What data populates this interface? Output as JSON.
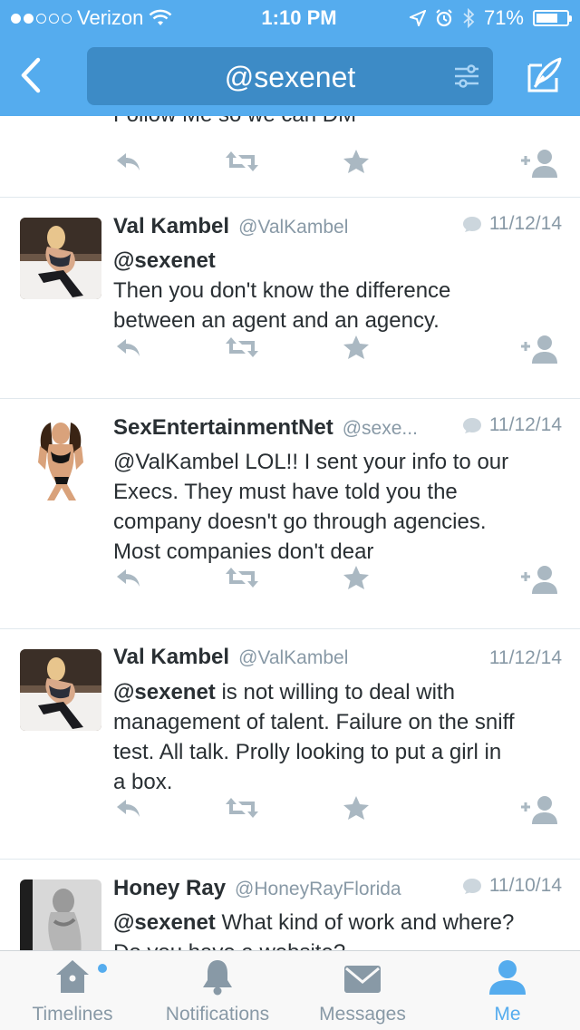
{
  "status_bar": {
    "carrier": "Verizon",
    "time": "1:10 PM",
    "battery": "71%",
    "battery_level": 0.71
  },
  "nav": {
    "title": "@sexenet",
    "back_icon": "chevron-left-icon",
    "filter_icon": "filter-sliders-icon",
    "compose_icon": "compose-quill-icon"
  },
  "feed": {
    "partial_top_text": "Follow Me so we can DM",
    "tweets": [
      {
        "name": "Val Kambel",
        "handle": "@ValKambel",
        "date": "11/12/14",
        "has_reply_indicator": true,
        "mention": "@sexenet",
        "text_line1": "Then you don't know the difference",
        "text_line2": "between an agent and an agency."
      },
      {
        "name": "SexEntertainmentNet",
        "handle": "@sexe...",
        "date": "11/12/14",
        "has_reply_indicator": true,
        "lines": [
          "@ValKambel LOL!! I sent your info to our",
          "Execs. They must have told you the",
          "company doesn't go through agencies.",
          "Most companies don't dear"
        ]
      },
      {
        "name": "Val Kambel",
        "handle": "@ValKambel",
        "date": "11/12/14",
        "has_reply_indicator": false,
        "mention": "@sexenet",
        "line1_rest": " is not willing to deal with",
        "lines": [
          "management of talent.  Failure on the sniff",
          "test. All talk.  Prolly looking to put a girl in",
          "a box."
        ]
      },
      {
        "name": "Honey Ray",
        "handle": "@HoneyRayFlorida",
        "date": "11/10/14",
        "has_reply_indicator": true,
        "mention": "@sexenet",
        "line1_rest": " What kind of work and where?",
        "line2": "Do you have a website?"
      }
    ]
  },
  "tabs": [
    {
      "label": "Timelines",
      "icon": "home-icon",
      "active": false
    },
    {
      "label": "Notifications",
      "icon": "bell-icon",
      "active": false
    },
    {
      "label": "Messages",
      "icon": "envelope-icon",
      "active": false
    },
    {
      "label": "Me",
      "icon": "person-icon",
      "active": true
    }
  ],
  "colors": {
    "brand_blue": "#55acee",
    "pill_blue": "#3d8bc6",
    "muted_gray": "#8899a6",
    "action_gray": "#aab8c2"
  }
}
